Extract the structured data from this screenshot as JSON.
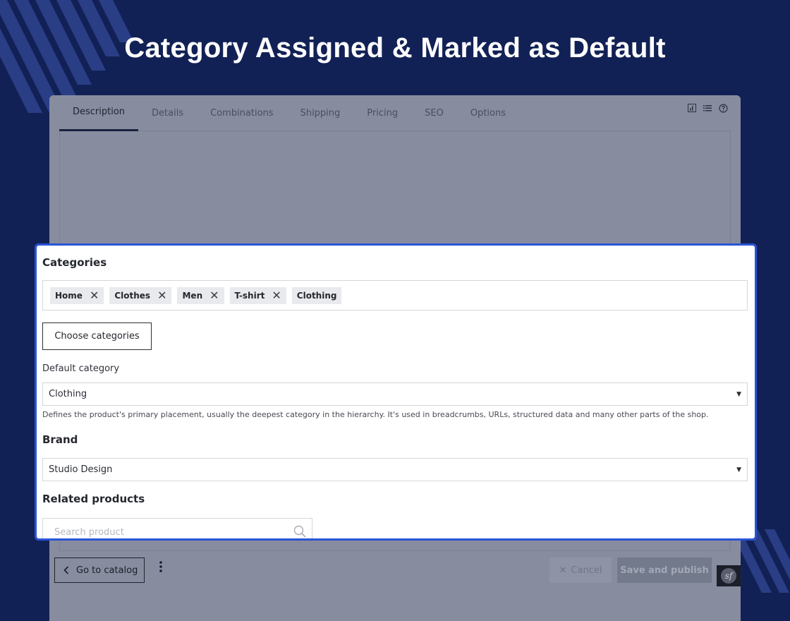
{
  "headline": "Category Assigned & Marked as Default",
  "tabs": [
    {
      "label": "Description",
      "active": true
    },
    {
      "label": "Details"
    },
    {
      "label": "Combinations"
    },
    {
      "label": "Shipping"
    },
    {
      "label": "Pricing"
    },
    {
      "label": "SEO"
    },
    {
      "label": "Options"
    }
  ],
  "toolbar_icons": [
    "chart-icon",
    "list-icon",
    "help-icon"
  ],
  "categories": {
    "title": "Categories",
    "tags": [
      {
        "label": "Home",
        "removable": true
      },
      {
        "label": "Clothes",
        "removable": true
      },
      {
        "label": "Men",
        "removable": true
      },
      {
        "label": "T-shirt",
        "removable": true
      },
      {
        "label": "Clothing",
        "removable": false
      }
    ],
    "remove_glyph": "✕",
    "choose_button": "Choose categories"
  },
  "default_category": {
    "label": "Default category",
    "value": "Clothing",
    "help": "Defines the product's primary placement, usually the deepest category in the hierarchy. It's used in breadcrumbs, URLs, structured data and many other parts of the shop."
  },
  "brand": {
    "title": "Brand",
    "value": "Studio Design"
  },
  "related_products": {
    "title": "Related products",
    "search_placeholder": "Search product"
  },
  "footer": {
    "go_to_catalog": "Go to catalog",
    "cancel": "Cancel",
    "save_and_publish": "Save and publish",
    "sf_badge": "sf"
  },
  "colors": {
    "page_bg": "#122155",
    "highlight_border": "#2a54d6",
    "panel_bg": "#ffffff"
  }
}
